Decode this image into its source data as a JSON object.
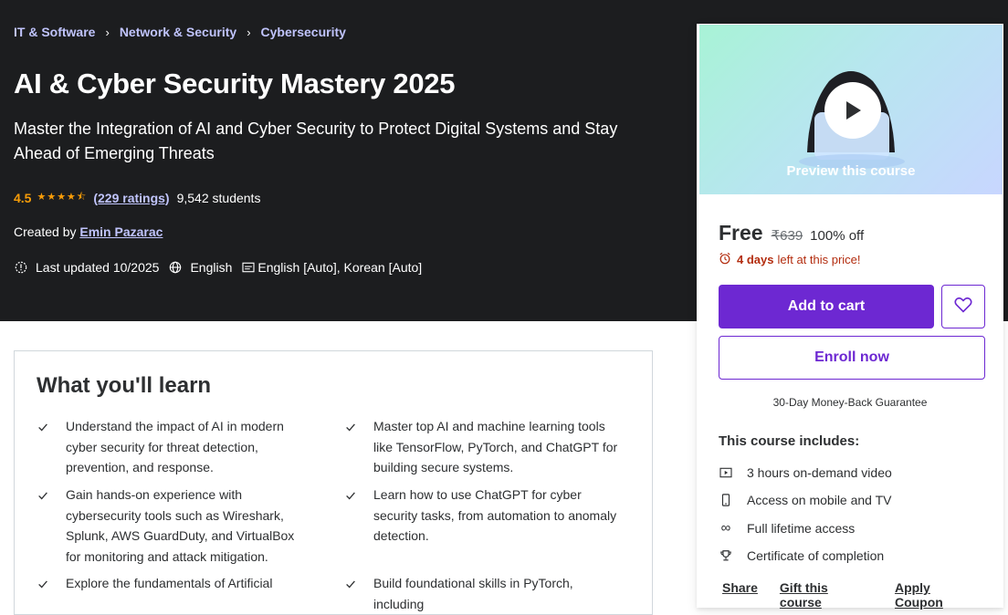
{
  "breadcrumb": [
    "IT & Software",
    "Network & Security",
    "Cybersecurity"
  ],
  "course": {
    "title": "AI & Cyber Security Mastery 2025",
    "subtitle": "Master the Integration of AI and Cyber Security to Protect Digital Systems and Stay Ahead of Emerging Threats",
    "rating": "4.5",
    "stars": "★★★★⯪",
    "ratings_count": "(229 ratings)",
    "students": "9,542 students",
    "created_by_label": "Created by",
    "instructor": "Emin Pazarac",
    "last_updated": "Last updated 10/2025",
    "language": "English",
    "captions": "English [Auto], Korean [Auto]"
  },
  "learn": {
    "title": "What you'll learn",
    "items": [
      "Understand the impact of AI in modern cyber security for threat detection, prevention, and response.",
      "Master top AI and machine learning tools like TensorFlow, PyTorch, and ChatGPT for building secure systems.",
      "Gain hands-on experience with cybersecurity tools such as Wireshark, Splunk, AWS GuardDuty, and VirtualBox for monitoring and attack mitigation.",
      "Learn how to use ChatGPT for cyber security tasks, from automation to anomaly detection.",
      "Explore the fundamentals of Artificial",
      "Build foundational skills in PyTorch, including"
    ]
  },
  "sidebar": {
    "preview_label": "Preview this course",
    "price_free": "Free",
    "price_old": "₹639",
    "discount": "100% off",
    "timer_days": "4 days",
    "timer_text": "left at this price!",
    "add_to_cart": "Add to cart",
    "enroll_now": "Enroll now",
    "guarantee": "30-Day Money-Back Guarantee",
    "includes_title": "This course includes:",
    "includes": [
      {
        "icon": "video-icon",
        "label": "3 hours on-demand video"
      },
      {
        "icon": "mobile-icon",
        "label": "Access on mobile and TV"
      },
      {
        "icon": "infinity-icon",
        "label": "Full lifetime access"
      },
      {
        "icon": "trophy-icon",
        "label": "Certificate of completion"
      }
    ],
    "links": [
      "Share",
      "Gift this course",
      "Apply Coupon"
    ]
  },
  "colors": {
    "hero_bg": "#1c1d1f",
    "accent_purple": "#6d28d2",
    "link_lavender": "#c0c4fc",
    "star_orange": "#f69c08",
    "timer_red": "#b32d0f"
  }
}
